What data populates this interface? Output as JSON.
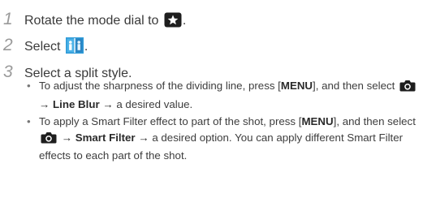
{
  "steps": [
    {
      "number": "1",
      "text": "Rotate the mode dial to",
      "suffix": ".",
      "icon": "smart-mode-star-icon"
    },
    {
      "number": "2",
      "text": "Select",
      "suffix": ".",
      "icon": "split-shot-icon"
    },
    {
      "number": "3",
      "text": "Select a split style."
    }
  ],
  "bullets": [
    {
      "bullet": "•",
      "p1": "To adjust the sharpness of the dividing line, press [",
      "menu": "MENU",
      "p2": "], and then select",
      "arrow1": "→",
      "option": "Line Blur",
      "arrow2": "→",
      "p3": "a desired value."
    },
    {
      "bullet": "•",
      "p1": "To apply a Smart Filter effect to part of the shot, press [",
      "menu": "MENU",
      "p2": "], and then select",
      "arrow1": "→",
      "option": "Smart Filter",
      "arrow2": "→",
      "p3": "a desired option. You can apply different Smart Filter effects to each part of the shot."
    }
  ],
  "icons": {
    "camera": "camera-icon",
    "accent": "#2f9bd8",
    "dark": "#222222"
  }
}
